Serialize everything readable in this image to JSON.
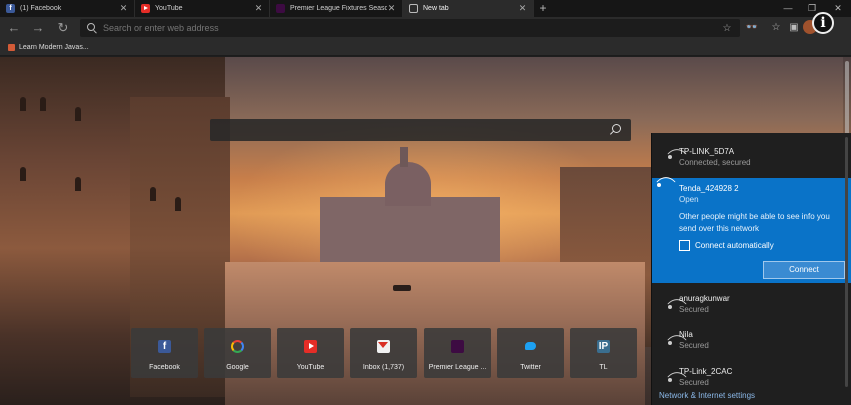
{
  "tabs": [
    {
      "title": "(1) Facebook",
      "icon": "facebook-icon"
    },
    {
      "title": "YouTube",
      "icon": "youtube-icon"
    },
    {
      "title": "Premier League Fixtures Season",
      "icon": "premier-league-icon"
    },
    {
      "title": "New tab",
      "icon": "new-tab-icon"
    }
  ],
  "address_bar": {
    "placeholder": "Search or enter web address"
  },
  "favorites": [
    {
      "label": "Learn Modern Javas..."
    }
  ],
  "new_tab": {
    "search_placeholder": ""
  },
  "quick_links": [
    {
      "label": "Facebook",
      "icon": "facebook-icon",
      "glyph": "f"
    },
    {
      "label": "Google",
      "icon": "google-icon",
      "glyph": ""
    },
    {
      "label": "YouTube",
      "icon": "youtube-icon",
      "glyph": ""
    },
    {
      "label": "Inbox (1,737)",
      "icon": "gmail-icon",
      "glyph": ""
    },
    {
      "label": "Premier League ...",
      "icon": "premier-league-icon",
      "glyph": ""
    },
    {
      "label": "Twitter",
      "icon": "twitter-icon",
      "glyph": ""
    },
    {
      "label": "TL",
      "icon": "tl-icon",
      "glyph": "IP"
    }
  ],
  "wifi": {
    "networks": [
      {
        "name": "TP-LINK_5D7A",
        "status": "Connected, secured"
      },
      {
        "name": "Tenda_424928 2",
        "status": "Open",
        "selected": true,
        "warning": "Other people might be able to see info you send over this network",
        "auto_connect_label": "Connect automatically",
        "connect_label": "Connect"
      },
      {
        "name": "anuragkunwar",
        "status": "Secured"
      },
      {
        "name": "Nila",
        "status": "Secured"
      },
      {
        "name": "TP-Link_2CAC",
        "status": "Secured"
      }
    ],
    "settings_label": "Network & Internet settings"
  },
  "colors": {
    "accent": "#0a73c8",
    "chrome": "#2b2b2b"
  }
}
